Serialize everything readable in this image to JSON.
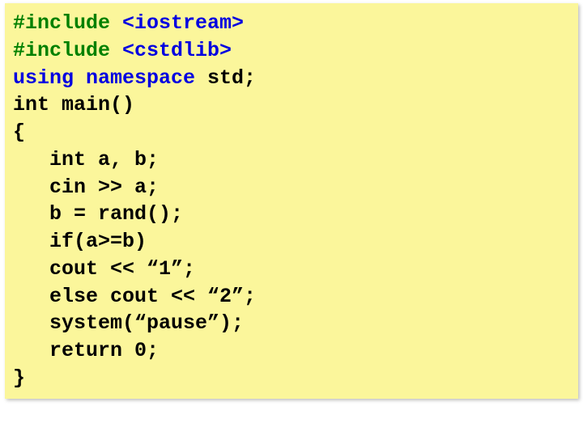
{
  "code": {
    "l1a": "#include ",
    "l1b": "<iostream>",
    "l2a": "#include ",
    "l2b": "<cstdlib>",
    "l3a": "using namespace",
    "l3b": " std;",
    "l4": "int main()",
    "l5": "{",
    "l6": "   int a, b;",
    "l7": "   cin >> a;",
    "l8": "   b = rand();",
    "l9": "   if(a>=b)",
    "l10": "   cout << “1”;",
    "l11": "   else cout << “2”;",
    "l12": "   system(“pause”);",
    "l13": "   return 0;",
    "l14": "}"
  }
}
